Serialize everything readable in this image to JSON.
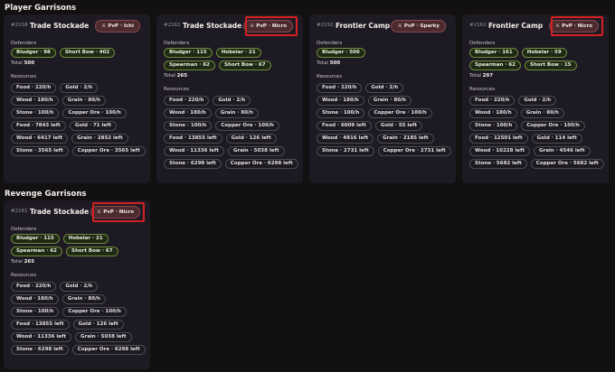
{
  "sections": {
    "player_title": "Player Garrisons",
    "revenge_title": "Revenge Garrisons"
  },
  "labels": {
    "defenders": "Defenders",
    "total": "Total",
    "resources": "Resources"
  },
  "cards": [
    {
      "id": "#2158",
      "name": "Trade Stockade",
      "pvp": "PvP · Ichi",
      "pvp_highlighted": false,
      "defenders": [
        "Bludger · 98",
        "Short Bow · 402"
      ],
      "total": "500",
      "resources": [
        "Food · 220/h",
        "Gold · 2/h",
        "Wood · 180/h",
        "Grain · 80/h",
        "Stone · 100/h",
        "Copper Ore · 100/h",
        "Food · 7843 left",
        "Gold · 71 left",
        "Wood · 6417 left",
        "Grain · 2852 left",
        "Stone · 3565 left",
        "Copper Ore · 3565 left"
      ]
    },
    {
      "id": "#2161",
      "name": "Trade Stockade",
      "pvp": "PvP · Nicro",
      "pvp_highlighted": true,
      "defenders": [
        "Bludger · 115",
        "Hobelar · 21",
        "Spearman · 62",
        "Short Bow · 67"
      ],
      "total": "265",
      "resources": [
        "Food · 220/h",
        "Gold · 2/h",
        "Wood · 180/h",
        "Grain · 80/h",
        "Stone · 100/h",
        "Copper Ore · 100/h",
        "Food · 13855 left",
        "Gold · 126 left",
        "Wood · 11336 left",
        "Grain · 5038 left",
        "Stone · 6298 left",
        "Copper Ore · 6298 left"
      ]
    },
    {
      "id": "#2152",
      "name": "Frontier Camp",
      "pvp": "PvP · Sparky",
      "pvp_highlighted": false,
      "defenders": [
        "Bludger · 500"
      ],
      "total": "500",
      "resources": [
        "Food · 220/h",
        "Gold · 2/h",
        "Wood · 180/h",
        "Grain · 80/h",
        "Stone · 100/h",
        "Copper Ore · 100/h",
        "Food · 6009 left",
        "Gold · 55 left",
        "Wood · 4916 left",
        "Grain · 2185 left",
        "Stone · 2731 left",
        "Copper Ore · 2731 left"
      ]
    },
    {
      "id": "#2162",
      "name": "Frontier Camp",
      "pvp": "PvP · Nicro",
      "pvp_highlighted": true,
      "defenders": [
        "Bludger · 161",
        "Hobelar · 59",
        "Spearman · 62",
        "Short Bow · 15"
      ],
      "total": "297",
      "resources": [
        "Food · 220/h",
        "Gold · 2/h",
        "Wood · 180/h",
        "Grain · 80/h",
        "Stone · 100/h",
        "Copper Ore · 100/h",
        "Food · 12501 left",
        "Gold · 114 left",
        "Wood · 10228 left",
        "Grain · 4546 left",
        "Stone · 5682 left",
        "Copper Ore · 5682 left"
      ]
    },
    {
      "id": "#2161",
      "name": "Trade Stockade",
      "pvp": "PvP · Nicro",
      "pvp_highlighted": true,
      "defenders": [
        "Bludger · 115",
        "Hobelar · 21",
        "Spearman · 62",
        "Short Bow · 67"
      ],
      "total": "265",
      "resources": [
        "Food · 220/h",
        "Gold · 2/h",
        "Wood · 180/h",
        "Grain · 80/h",
        "Stone · 100/h",
        "Copper Ore · 100/h",
        "Food · 13855 left",
        "Gold · 126 left",
        "Wood · 11336 left",
        "Grain · 5038 left",
        "Stone · 6298 left",
        "Copper Ore · 6298 left"
      ]
    }
  ],
  "colors": {
    "background": "#121010",
    "card": "#1e1a24",
    "defender_pill_border": "#6f8a3c",
    "pvp_badge": "#4c2a2e",
    "highlight": "#d42020"
  },
  "icons": {
    "pvp": "crossed-swords-icon"
  }
}
